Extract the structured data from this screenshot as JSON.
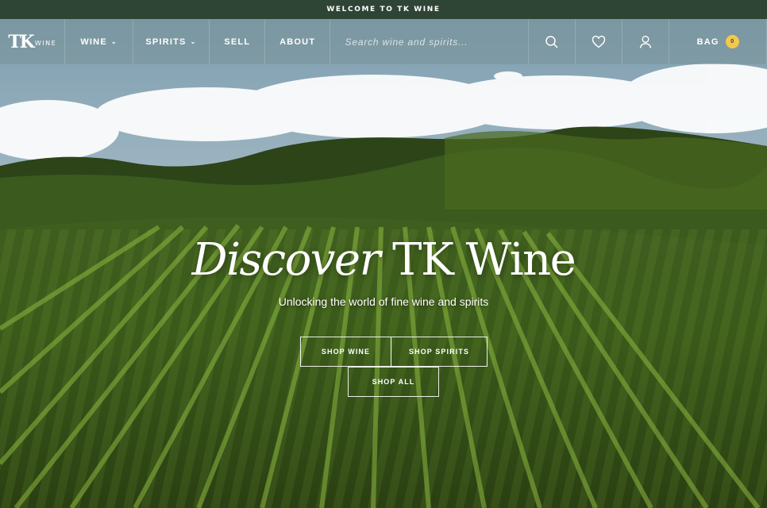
{
  "announcement": "WELCOME TO TK WINE",
  "logo": {
    "main": "TK",
    "sub": "WINE"
  },
  "nav": {
    "links": [
      {
        "label": "WINE",
        "dropdown": true
      },
      {
        "label": "SPIRITS",
        "dropdown": true
      },
      {
        "label": "SELL",
        "dropdown": false
      },
      {
        "label": "ABOUT",
        "dropdown": false
      }
    ],
    "search_placeholder": "Search wine and spirits...",
    "icons": [
      "search-icon",
      "heart-icon",
      "user-icon"
    ],
    "bag_label": "BAG",
    "bag_count": "0"
  },
  "hero": {
    "headline_italic": "Discover",
    "headline_rest": " TK Wine",
    "subtitle": "Unlocking the world of fine wine and spirits",
    "buttons": {
      "shop_wine": "SHOP WINE",
      "shop_spirits": "SHOP SPIRITS",
      "shop_all": "SHOP ALL"
    }
  },
  "colors": {
    "announce_bg": "#2e4536",
    "badge": "#f2c94c",
    "accent_white": "#ffffff"
  }
}
